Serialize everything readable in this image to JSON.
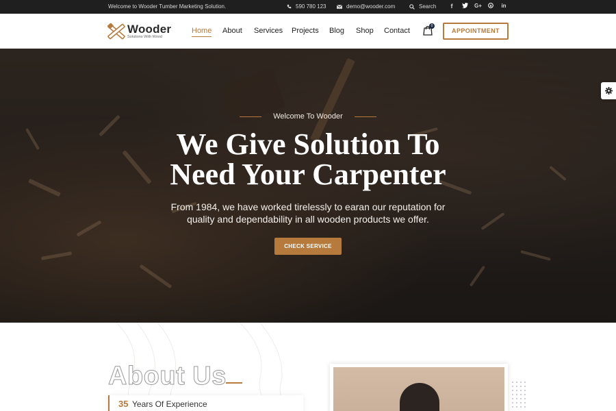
{
  "topbar": {
    "welcome": "Welcome to Wooder Tumber Marketing Solution.",
    "phone": "590 780 123",
    "email": "demo@wooder.com",
    "search": "Search",
    "social": [
      "facebook-icon",
      "twitter-icon",
      "google-plus-icon",
      "skype-icon",
      "linkedin-icon"
    ]
  },
  "header": {
    "brand": "Wooder",
    "tagline": "Solutions With Wood",
    "nav": [
      "Home",
      "About",
      "Services",
      "Projects",
      "Blog",
      "Shop",
      "Contact"
    ],
    "active_nav": "Home",
    "cart_count": "0",
    "appointment": "APPOINTMENT"
  },
  "hero": {
    "welcome": "Welcome To Wooder",
    "title_line1": "We Give Solution To",
    "title_line2": "Need Your Carpenter",
    "sub_line1": "From 1984, we have worked tirelessly to earan our reputation for",
    "sub_line2": "quality and dependability in all wooden products we offer.",
    "button": "CHECK SERVICE"
  },
  "about": {
    "title": "About Us",
    "experience_number": "35",
    "experience_label": "Years Of Experience"
  },
  "colors": {
    "accent": "#b67a3d",
    "dark": "#1f1f1f"
  }
}
